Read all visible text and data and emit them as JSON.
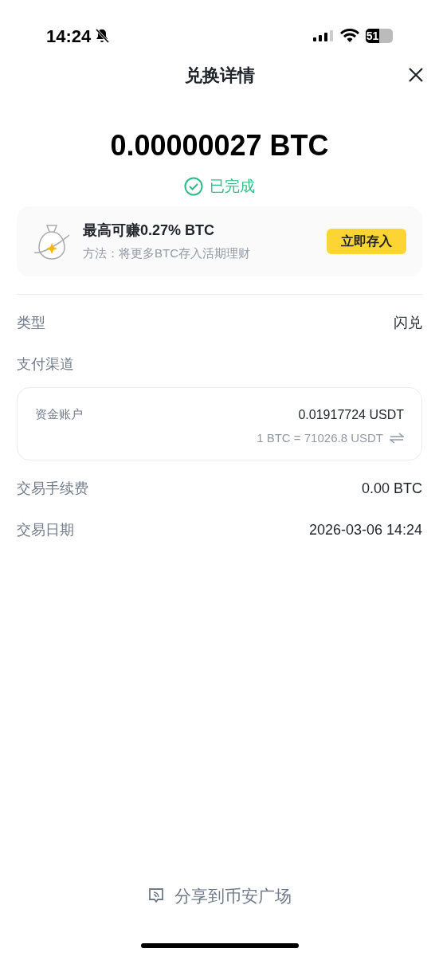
{
  "status_bar": {
    "time": "14:24",
    "battery": "51"
  },
  "header": {
    "title": "兑换详情"
  },
  "amount": "0.00000027 BTC",
  "status": {
    "label": "已完成",
    "completed": true
  },
  "promo": {
    "title": "最高可赚0.27% BTC",
    "subtitle": "方法：将更多BTC存入活期理财",
    "button": "立即存入"
  },
  "details": [
    {
      "label": "类型",
      "value": "闪兑"
    }
  ],
  "payment": {
    "label": "支付渠道",
    "account": "资金账户",
    "amount": "0.01917724 USDT",
    "rate": "1 BTC = 71026.8 USDT"
  },
  "details_2": [
    {
      "label": "交易手续费",
      "value": "0.00 BTC"
    },
    {
      "label": "交易日期",
      "value": "2026-03-06 14:24"
    }
  ],
  "share": {
    "label": "分享到币安广场"
  }
}
